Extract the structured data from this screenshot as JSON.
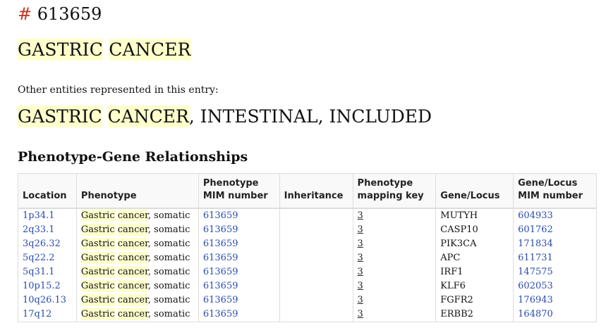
{
  "entry": {
    "hash": "#",
    "number": "613659"
  },
  "title": {
    "words": [
      "GASTRIC",
      "CANCER"
    ]
  },
  "other_entities_label": "Other entities represented in this entry:",
  "included": {
    "w1": "GASTRIC",
    "w2": "CANCER",
    "rest": ", INTESTINAL, INCLUDED"
  },
  "section_title": "Phenotype-Gene Relationships",
  "table": {
    "headers": {
      "location": "Location",
      "phenotype": "Phenotype",
      "pheno_mim_1": "Phenotype",
      "pheno_mim_2": "MIM number",
      "inheritance": "Inheritance",
      "pheno_key_1": "Phenotype",
      "pheno_key_2": "mapping key",
      "gene": "Gene/Locus",
      "gene_mim_1": "Gene/Locus",
      "gene_mim_2": "MIM number"
    },
    "rows": [
      {
        "location": "1p34.1",
        "ph1": "Gastric",
        "ph2": "cancer",
        "ph3": ", somatic",
        "pheno_mim": "613659",
        "inheritance": "",
        "key": "3",
        "gene": "MUTYH",
        "gene_mim": "604933"
      },
      {
        "location": "2q33.1",
        "ph1": "Gastric",
        "ph2": "cancer",
        "ph3": ", somatic",
        "pheno_mim": "613659",
        "inheritance": "",
        "key": "3",
        "gene": "CASP10",
        "gene_mim": "601762"
      },
      {
        "location": "3q26.32",
        "ph1": "Gastric",
        "ph2": "cancer",
        "ph3": ", somatic",
        "pheno_mim": "613659",
        "inheritance": "",
        "key": "3",
        "gene": "PIK3CA",
        "gene_mim": "171834"
      },
      {
        "location": "5q22.2",
        "ph1": "Gastric",
        "ph2": "cancer",
        "ph3": ", somatic",
        "pheno_mim": "613659",
        "inheritance": "",
        "key": "3",
        "gene": "APC",
        "gene_mim": "611731"
      },
      {
        "location": "5q31.1",
        "ph1": "Gastric",
        "ph2": "cancer",
        "ph3": ", somatic",
        "pheno_mim": "613659",
        "inheritance": "",
        "key": "3",
        "gene": "IRF1",
        "gene_mim": "147575"
      },
      {
        "location": "10p15.2",
        "ph1": "Gastric",
        "ph2": "cancer",
        "ph3": ", somatic",
        "pheno_mim": "613659",
        "inheritance": "",
        "key": "3",
        "gene": "KLF6",
        "gene_mim": "602053"
      },
      {
        "location": "10q26.13",
        "ph1": "Gastric",
        "ph2": "cancer",
        "ph3": ", somatic",
        "pheno_mim": "613659",
        "inheritance": "",
        "key": "3",
        "gene": "FGFR2",
        "gene_mim": "176943"
      },
      {
        "location": "17q12",
        "ph1": "Gastric",
        "ph2": "cancer",
        "ph3": ", somatic",
        "pheno_mim": "613659",
        "inheritance": "",
        "key": "3",
        "gene": "ERBB2",
        "gene_mim": "164870"
      }
    ]
  },
  "colors": {
    "link": "#2a4bb0",
    "highlight": "#ffffcc",
    "hash": "#c0392b"
  }
}
